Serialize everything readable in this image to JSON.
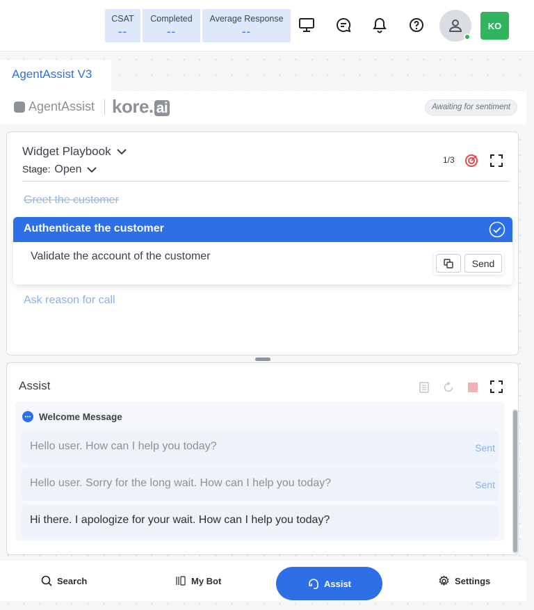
{
  "header": {
    "stats": [
      {
        "label": "CSAT",
        "value": "--"
      },
      {
        "label": "Completed",
        "value": "--"
      },
      {
        "label": "Average Response",
        "value": "--"
      }
    ],
    "avatar_initials": "KO"
  },
  "app_tab": {
    "title": "AgentAssist V3"
  },
  "brand": {
    "product": "AgentAssist",
    "company": "kore",
    "company_suffix": "ai",
    "sentiment_status": "Awaiting for sentiment"
  },
  "playbook": {
    "title": "Widget Playbook",
    "stage_label": "Stage:",
    "stage_value": "Open",
    "step_counter": "1/3",
    "steps": {
      "completed": "Greet the customer",
      "active": {
        "title": "Authenticate the customer",
        "body": "Validate the account of the customer",
        "send_label": "Send"
      },
      "next": "Ask reason for call"
    }
  },
  "assist": {
    "title": "Assist",
    "section_title": "Welcome Message",
    "messages": [
      {
        "text": "Hello user. How can I help you today?",
        "status": "Sent"
      },
      {
        "text": "Hello user. Sorry for the long wait. How can I help you today?",
        "status": "Sent"
      },
      {
        "text": "Hi there. I apologize for your wait. How can I help you today?"
      }
    ]
  },
  "bottom_nav": {
    "items": [
      {
        "label": "Search",
        "icon": "search-icon"
      },
      {
        "label": "My Bot",
        "icon": "bot-icon"
      },
      {
        "label": "Assist",
        "icon": "assist-icon",
        "active": true
      },
      {
        "label": "Settings",
        "icon": "gear-icon"
      }
    ]
  },
  "colors": {
    "primary": "#2d6fe6",
    "online": "#2eb84f",
    "avatar_bg": "#30b55e",
    "stat_bg": "#dde9fb"
  }
}
